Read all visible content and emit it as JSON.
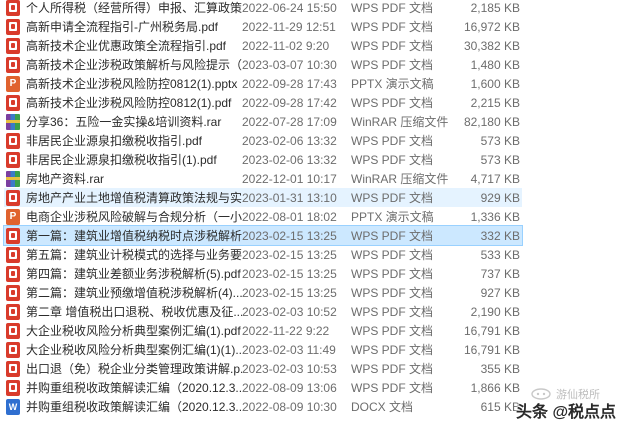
{
  "files": [
    {
      "name": "个人所得税（经营所得）申报、汇算政策...",
      "date": "2022-06-24 15:50",
      "type": "WPS PDF 文档",
      "size": "2,185 KB",
      "icon": "pdf"
    },
    {
      "name": "高新申请全流程指引-广州税务局.pdf",
      "date": "2022-11-29 12:51",
      "type": "WPS PDF 文档",
      "size": "16,972 KB",
      "icon": "pdf"
    },
    {
      "name": "高新技术企业优惠政策全流程指引.pdf",
      "date": "2022-11-02 9:20",
      "type": "WPS PDF 文档",
      "size": "30,382 KB",
      "icon": "pdf"
    },
    {
      "name": "高新技术企业涉税政策解析与风险提示（2...",
      "date": "2023-03-07 10:30",
      "type": "WPS PDF 文档",
      "size": "1,480 KB",
      "icon": "pdf"
    },
    {
      "name": "高新技术企业涉税风险防控0812(1).pptx",
      "date": "2022-09-28 17:43",
      "type": "PPTX 演示文稿",
      "size": "1,600 KB",
      "icon": "ppt"
    },
    {
      "name": "高新技术企业涉税风险防控0812(1).pdf",
      "date": "2022-09-28 17:42",
      "type": "WPS PDF 文档",
      "size": "2,215 KB",
      "icon": "pdf"
    },
    {
      "name": "分享36：五险一金实操&培训资料.rar",
      "date": "2022-07-28 17:09",
      "type": "WinRAR 压缩文件",
      "size": "82,180 KB",
      "icon": "rar"
    },
    {
      "name": "非居民企业源泉扣缴税收指引.pdf",
      "date": "2023-02-06 13:32",
      "type": "WPS PDF 文档",
      "size": "573 KB",
      "icon": "pdf"
    },
    {
      "name": "非居民企业源泉扣缴税收指引(1).pdf",
      "date": "2023-02-06 13:32",
      "type": "WPS PDF 文档",
      "size": "573 KB",
      "icon": "pdf"
    },
    {
      "name": "房地产资料.rar",
      "date": "2022-12-01 10:17",
      "type": "WinRAR 压缩文件",
      "size": "4,717 KB",
      "icon": "rar"
    },
    {
      "name": "房地产产业土地增值税清算政策法规与实...",
      "date": "2023-01-31 13:10",
      "type": "WPS PDF 文档",
      "size": "929 KB",
      "icon": "pdf"
    },
    {
      "name": "电商企业涉税风险破解与合规分析（一小...",
      "date": "2022-08-01 18:02",
      "type": "PPTX 演示文稿",
      "size": "1,336 KB",
      "icon": "ppt"
    },
    {
      "name": "第一篇：建筑业增值税纳税时点涉税解析...",
      "date": "2023-02-15 13:25",
      "type": "WPS PDF 文档",
      "size": "332 KB",
      "icon": "pdf"
    },
    {
      "name": "第五篇：建筑业计税模式的选择与业务要...",
      "date": "2023-02-15 13:25",
      "type": "WPS PDF 文档",
      "size": "533 KB",
      "icon": "pdf"
    },
    {
      "name": "第四篇：建筑业差额业务涉税解析(5).pdf",
      "date": "2023-02-15 13:25",
      "type": "WPS PDF 文档",
      "size": "737 KB",
      "icon": "pdf"
    },
    {
      "name": "第二篇：建筑业预缴增值税涉税解析(4)....",
      "date": "2023-02-15 13:25",
      "type": "WPS PDF 文档",
      "size": "927 KB",
      "icon": "pdf"
    },
    {
      "name": "第二章 增值税出口退税、税收优惠及征...",
      "date": "2023-02-03 10:52",
      "type": "WPS PDF 文档",
      "size": "2,190 KB",
      "icon": "pdf"
    },
    {
      "name": "大企业税收风险分析典型案例汇编(1).pdf",
      "date": "2022-11-22 9:22",
      "type": "WPS PDF 文档",
      "size": "16,791 KB",
      "icon": "pdf"
    },
    {
      "name": "大企业税收风险分析典型案例汇编(1)(1)....",
      "date": "2023-02-03 11:49",
      "type": "WPS PDF 文档",
      "size": "16,791 KB",
      "icon": "pdf"
    },
    {
      "name": "出口退（免）税企业分类管理政策讲解.p...",
      "date": "2023-02-03 10:53",
      "type": "WPS PDF 文档",
      "size": "355 KB",
      "icon": "pdf"
    },
    {
      "name": "并购重组税收政策解读汇编（2020.12.3...",
      "date": "2022-08-09 13:06",
      "type": "WPS PDF 文档",
      "size": "1,866 KB",
      "icon": "pdf"
    },
    {
      "name": "并购重组税收政策解读汇编（2020.12.3...",
      "date": "2022-08-09 10:30",
      "type": "DOCX 文档",
      "size": "615 KB",
      "icon": "doc"
    }
  ],
  "watermark": {
    "sub": "游仙税所",
    "main": "头条 @税点点"
  }
}
